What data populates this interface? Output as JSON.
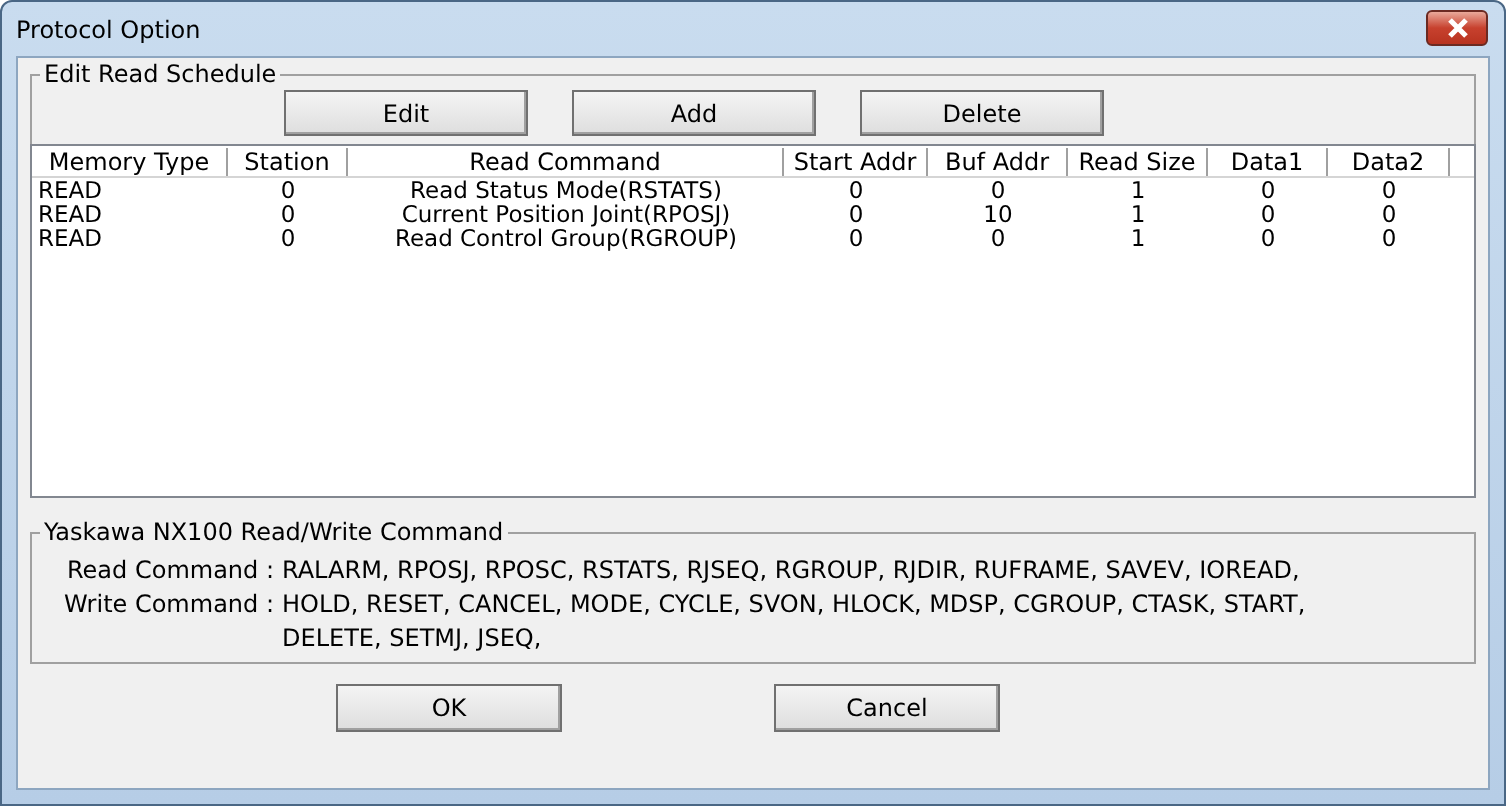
{
  "window": {
    "title": "Protocol Option"
  },
  "schedule": {
    "title": "Edit Read Schedule",
    "buttons": [
      "Edit",
      "Add",
      "Delete"
    ],
    "table": {
      "columns": [
        "Memory Type",
        "Station",
        "Read Command",
        "Start Addr",
        "Buf Addr",
        "Read Size",
        "Data1",
        "Data2"
      ],
      "rows": [
        [
          "READ",
          "0",
          "Read Status Mode(RSTATS)",
          "0",
          "0",
          "1",
          "0",
          "0"
        ],
        [
          "READ",
          "0",
          "Current Position Joint(RPOSJ)",
          "0",
          "10",
          "1",
          "0",
          "0"
        ],
        [
          "READ",
          "0",
          "Read Control Group(RGROUP)",
          "0",
          "0",
          "1",
          "0",
          "0"
        ]
      ]
    }
  },
  "commands": {
    "title": "Yaskawa NX100 Read/Write Command",
    "lines": [
      {
        "label": "Read Command :",
        "value": "RALARM, RPOSJ, RPOSC, RSTATS, RJSEQ, RGROUP, RJDIR, RUFRAME, SAVEV, IOREAD,"
      },
      {
        "label": "Write Command :",
        "value": "HOLD, RESET, CANCEL, MODE, CYCLE, SVON, HLOCK, MDSP, CGROUP, CTASK, START, DELETE, SETMJ, JSEQ,"
      }
    ]
  },
  "buttons": [
    "OK",
    "Cancel"
  ]
}
